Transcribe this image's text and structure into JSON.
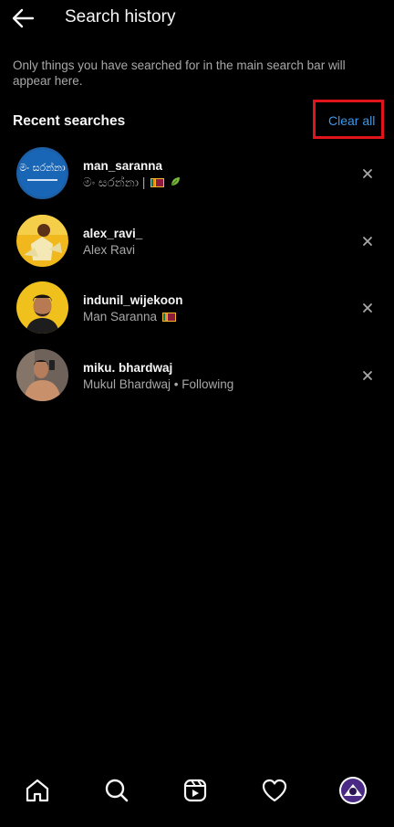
{
  "header": {
    "title": "Search history",
    "back_icon": "arrow-left-icon"
  },
  "info_text": "Only things you have searched for in the main search bar will appear here.",
  "recent": {
    "title": "Recent searches",
    "clear_all": "Clear all",
    "highlight_color": "#e0151b",
    "link_color": "#3e97e8"
  },
  "searches": [
    {
      "username": "man_saranna",
      "subtitle": "මං සරන්නා |",
      "badges": [
        "flag-icon",
        "leaf-icon"
      ],
      "avatar_text": "මං සරන්නා"
    },
    {
      "username": "alex_ravi_",
      "subtitle": "Alex Ravi",
      "badges": []
    },
    {
      "username": "indunil_wijekoon",
      "subtitle": "Man Saranna",
      "badges": [
        "flag-icon"
      ]
    },
    {
      "username": "miku. bhardwaj",
      "subtitle": "Mukul Bhardwaj • Following",
      "badges": []
    }
  ],
  "nav": {
    "items": [
      "home-icon",
      "search-icon",
      "reels-icon",
      "heart-icon",
      "profile-avatar"
    ]
  }
}
